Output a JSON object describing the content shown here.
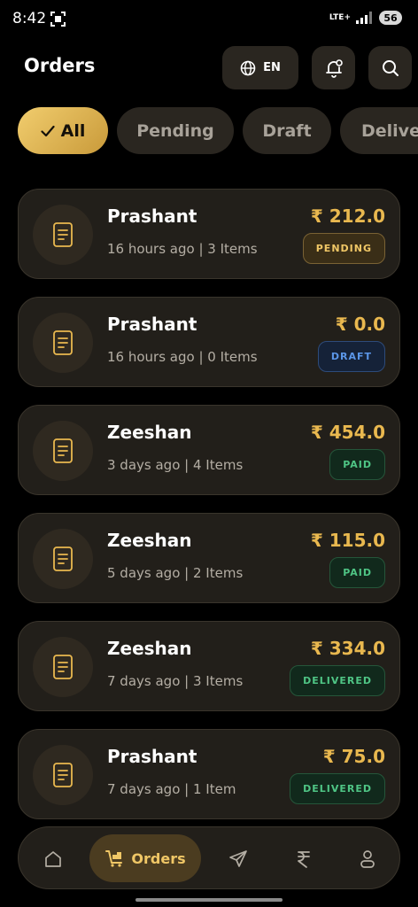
{
  "status_bar": {
    "time": "8:42",
    "network": "LTE+",
    "battery": "56"
  },
  "header": {
    "title": "Orders",
    "language": "EN"
  },
  "filters": [
    {
      "label": "All",
      "active": true
    },
    {
      "label": "Pending",
      "active": false
    },
    {
      "label": "Draft",
      "active": false
    },
    {
      "label": "Delive",
      "active": false
    }
  ],
  "orders": [
    {
      "name": "Prashant",
      "time": "16 hours ago",
      "items": "| 3 Items",
      "amount": "₹ 212.0",
      "status": "PENDING"
    },
    {
      "name": "Prashant",
      "time": "16 hours ago",
      "items": "| 0 Items",
      "amount": "₹ 0.0",
      "status": "DRAFT"
    },
    {
      "name": "Zeeshan",
      "time": "3 days ago",
      "items": "| 4 Items",
      "amount": "₹ 454.0",
      "status": "PAID"
    },
    {
      "name": "Zeeshan",
      "time": "5 days ago",
      "items": "| 2 Items",
      "amount": "₹ 115.0",
      "status": "PAID"
    },
    {
      "name": "Zeeshan",
      "time": "7 days ago",
      "items": "| 3 Items",
      "amount": "₹ 334.0",
      "status": "DELIVERED"
    },
    {
      "name": "Prashant",
      "time": "7 days ago",
      "items": "| 1 Item",
      "amount": "₹ 75.0",
      "status": "DELIVERED"
    }
  ],
  "bottom_nav": {
    "home_icon": "home-icon",
    "orders_label": "Orders",
    "send_icon": "send-icon",
    "rupee_icon": "rupee-icon",
    "profile_icon": "profile-icon"
  },
  "colors": {
    "accent_gold": "#e9b84f",
    "background": "#000000",
    "card": "#221f1a"
  }
}
